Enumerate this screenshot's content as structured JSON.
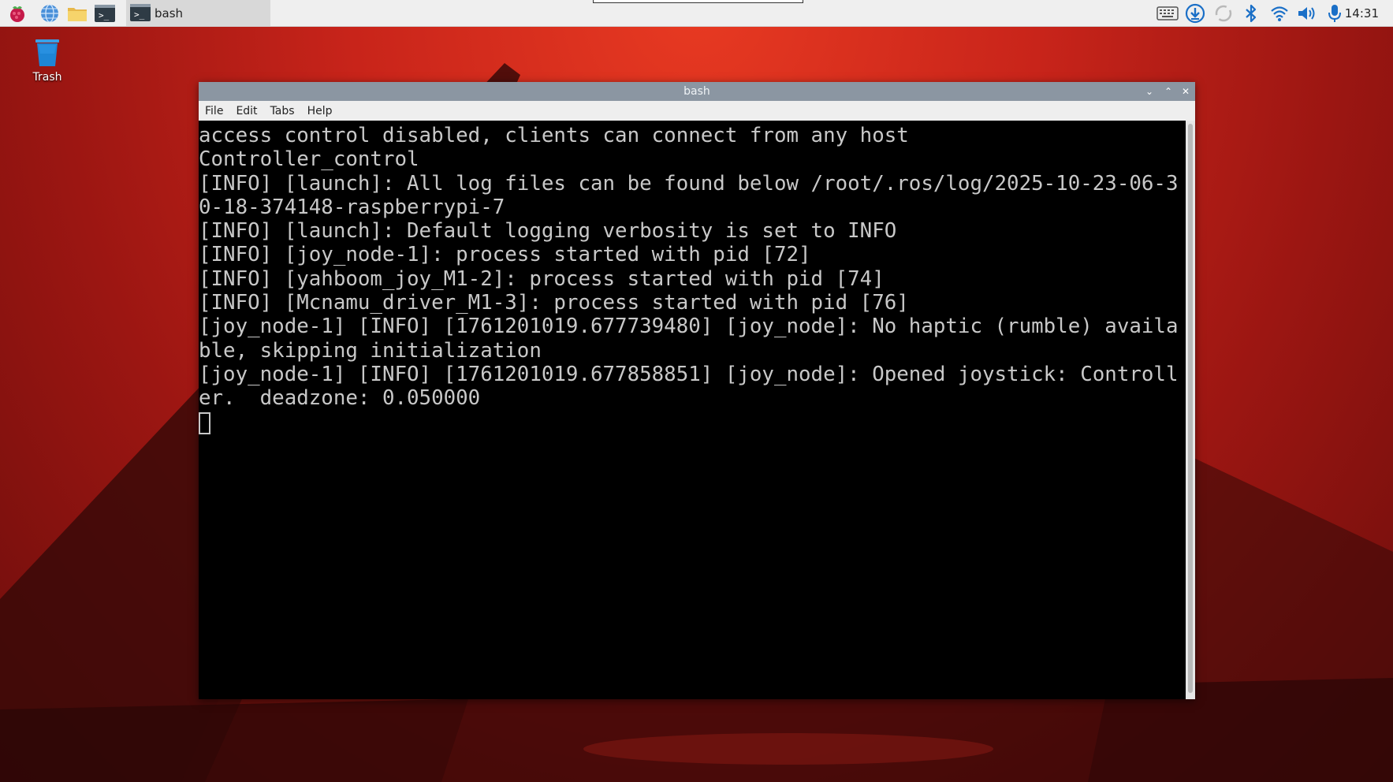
{
  "taskbar": {
    "launchers": [
      {
        "name": "raspberry-menu-icon"
      },
      {
        "name": "web-browser-icon"
      },
      {
        "name": "file-manager-icon"
      },
      {
        "name": "terminal-icon"
      }
    ],
    "task_label": "bash",
    "clock": "14:31"
  },
  "desktop": {
    "trash_label": "Trash"
  },
  "window": {
    "title": "bash",
    "menu": [
      "File",
      "Edit",
      "Tabs",
      "Help"
    ],
    "terminal_lines": [
      "access control disabled, clients can connect from any host",
      "Controller_control",
      "[INFO] [launch]: All log files can be found below /root/.ros/log/2025-10-23-06-3",
      "0-18-374148-raspberrypi-7",
      "[INFO] [launch]: Default logging verbosity is set to INFO",
      "[INFO] [joy_node-1]: process started with pid [72]",
      "[INFO] [yahboom_joy_M1-2]: process started with pid [74]",
      "[INFO] [Mcnamu_driver_M1-3]: process started with pid [76]",
      "[joy_node-1] [INFO] [1761201019.677739480] [joy_node]: No haptic (rumble) availa",
      "ble, skipping initialization",
      "[joy_node-1] [INFO] [1761201019.677858851] [joy_node]: Opened joystick: Controll",
      "er.  deadzone: 0.050000"
    ]
  },
  "colors": {
    "terminal_bg": "#000000",
    "terminal_fg": "#c8c8c8",
    "titlebar": "#8b96a2"
  }
}
